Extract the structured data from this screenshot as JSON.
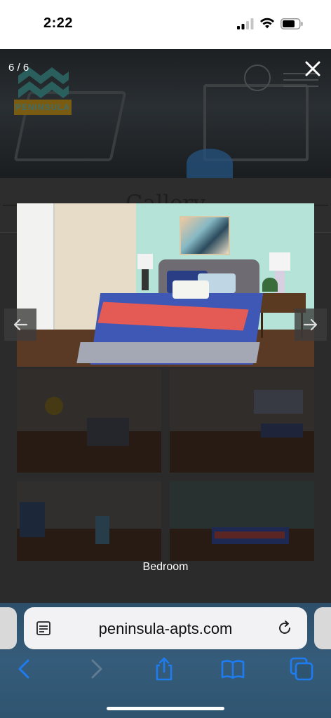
{
  "status_bar": {
    "time": "2:22"
  },
  "lightbox": {
    "counter": "6 / 6",
    "caption": "Bedroom"
  },
  "page": {
    "logo_text": "PENINSULA",
    "section_title": "Gallery"
  },
  "browser": {
    "url": "peninsula-apts.com"
  },
  "icons": {
    "close": "close-icon",
    "prev": "arrow-left-icon",
    "next": "arrow-right-icon",
    "reader": "reader-icon",
    "reload": "reload-icon",
    "back": "chevron-left-icon",
    "forward": "chevron-right-icon",
    "share": "share-icon",
    "bookmarks": "book-icon",
    "tabs": "tabs-icon"
  },
  "colors": {
    "safari_accent": "#1e7cf0",
    "overlay": "#2d2d2e"
  }
}
